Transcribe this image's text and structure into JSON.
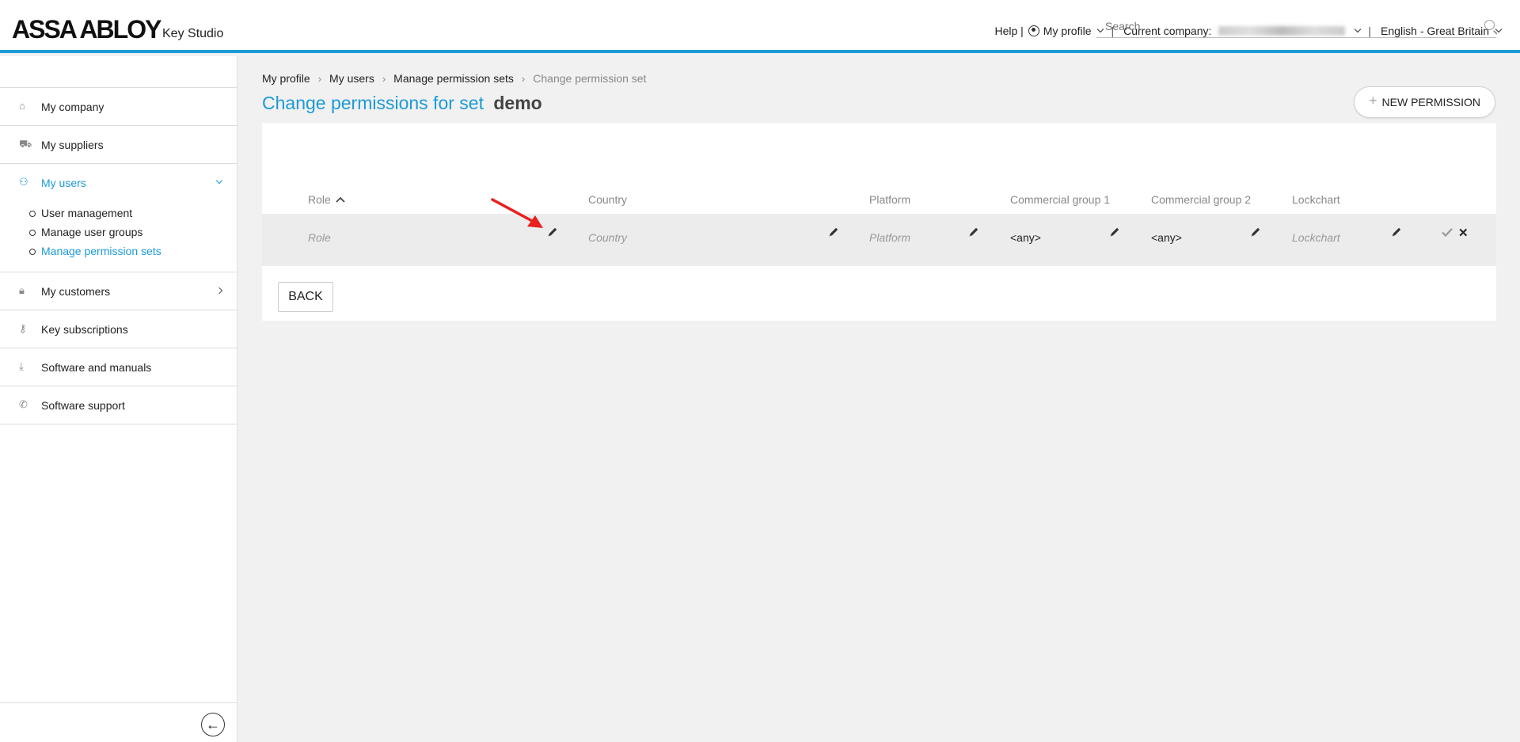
{
  "header": {
    "brand": "ASSA ABLOY",
    "app_name": "Key Studio",
    "help": "Help |",
    "my_profile": "My profile",
    "profile_sep": "|",
    "current_company_label": "Current company:",
    "company_sep": "|",
    "language": "English - Great Britain"
  },
  "sidebar": {
    "items": [
      {
        "label": "My company",
        "icon": "home-icon"
      },
      {
        "label": "My suppliers",
        "icon": "truck-icon"
      },
      {
        "label": "My users",
        "icon": "user-icon"
      },
      {
        "label": "My customers",
        "icon": "lock-icon"
      },
      {
        "label": "Key subscriptions",
        "icon": "key-icon"
      },
      {
        "label": "Software and manuals",
        "icon": "download-icon"
      },
      {
        "label": "Software support",
        "icon": "phone-icon"
      }
    ],
    "sub_items": [
      "User management",
      "Manage user groups",
      "Manage permission sets"
    ]
  },
  "breadcrumb": [
    "My profile",
    "My users",
    "Manage permission sets",
    "Change permission set"
  ],
  "page": {
    "title": "Change permissions for set",
    "set_name": "demo",
    "new_permission": "NEW PERMISSION",
    "back": "BACK"
  },
  "search": {
    "placeholder": "Search"
  },
  "table": {
    "columns": [
      "Role",
      "Country",
      "Platform",
      "Commercial group 1",
      "Commercial group 2",
      "Lockchart"
    ],
    "row": [
      "Role",
      "Country",
      "Platform",
      "<any>",
      "<any>",
      "Lockchart"
    ]
  },
  "colors": {
    "accent": "#1c9ad6",
    "annotation": "#e82020"
  }
}
